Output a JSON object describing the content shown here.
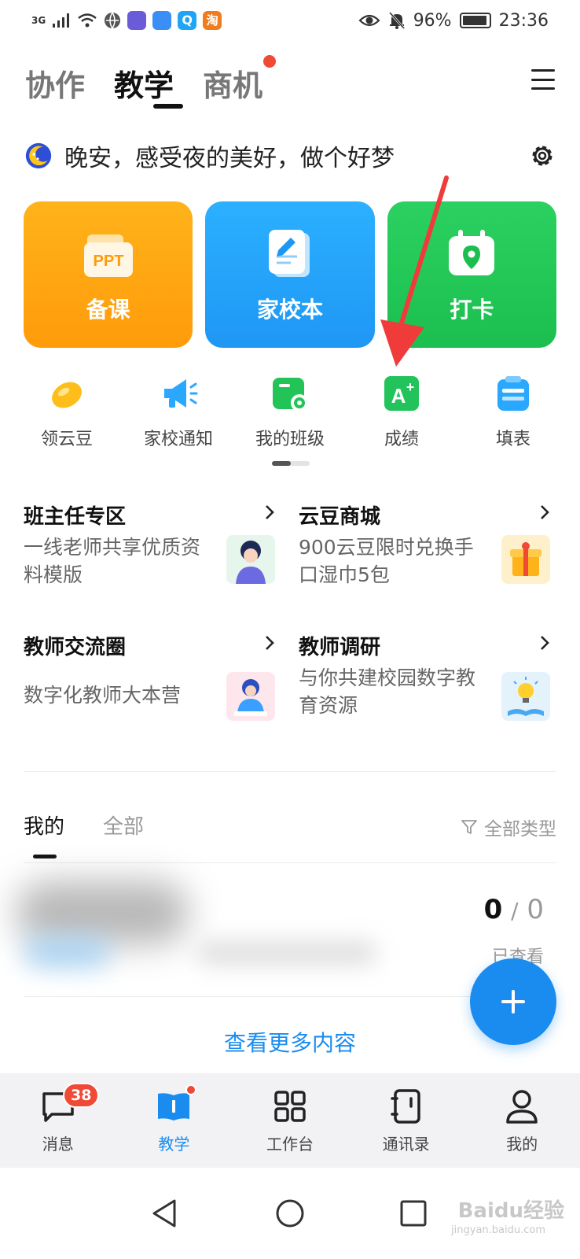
{
  "status_bar": {
    "network": "3G",
    "battery": "96%",
    "time": "23:36",
    "app_icon_colors": [
      "#6a5cd8",
      "#3a8ef5",
      "#1ea5f5",
      "#f07c1e"
    ],
    "app_icon_texts": [
      "",
      "",
      "Q",
      "淘"
    ]
  },
  "top_tabs": [
    {
      "label": "协作"
    },
    {
      "label": "教学"
    },
    {
      "label": "商机"
    }
  ],
  "active_top_tab": "教学",
  "greeting": {
    "text": "晚安，感受夜的美好，做个好梦"
  },
  "big_cards": [
    {
      "label": "备课",
      "icon": "ppt-folder-icon",
      "color": "#ffa512"
    },
    {
      "label": "家校本",
      "icon": "notebook-pencil-icon",
      "color": "#24a4fb"
    },
    {
      "label": "打卡",
      "icon": "calendar-location-icon",
      "color": "#22c858"
    }
  ],
  "tools": [
    {
      "label": "领云豆",
      "icon": "yellow-bean-icon"
    },
    {
      "label": "家校通知",
      "icon": "megaphone-icon"
    },
    {
      "label": "我的班级",
      "icon": "class-folder-icon"
    },
    {
      "label": "成绩",
      "icon": "grade-a-plus-icon"
    },
    {
      "label": "填表",
      "icon": "form-clipboard-icon"
    }
  ],
  "features": [
    {
      "title": "班主任专区",
      "desc": "一线老师共享优质资料模版"
    },
    {
      "title": "云豆商城",
      "desc": "900云豆限时兑换手口湿巾5包"
    },
    {
      "title": "教师交流圈",
      "desc": "数字化教师大本营"
    },
    {
      "title": "教师调研",
      "desc": "与你共建校园数字教育资源"
    }
  ],
  "content_tabs": {
    "mine": "我的",
    "all": "全部",
    "filter": "全部类型"
  },
  "item": {
    "viewed_count": "0",
    "separator": "/",
    "total": "0",
    "viewed_label": "已查看"
  },
  "more_link": "查看更多内容",
  "fab_label": "+",
  "bottom_nav": [
    {
      "label": "消息",
      "badge": "38"
    },
    {
      "label": "教学"
    },
    {
      "label": "工作台"
    },
    {
      "label": "通讯录"
    },
    {
      "label": "我的"
    }
  ],
  "active_bottom_tab": "教学",
  "accent_color": "#1a8cf0",
  "badge_color": "#f04a36",
  "watermark": {
    "text": "Baidu经验",
    "sub": "jingyan.baidu.com"
  }
}
